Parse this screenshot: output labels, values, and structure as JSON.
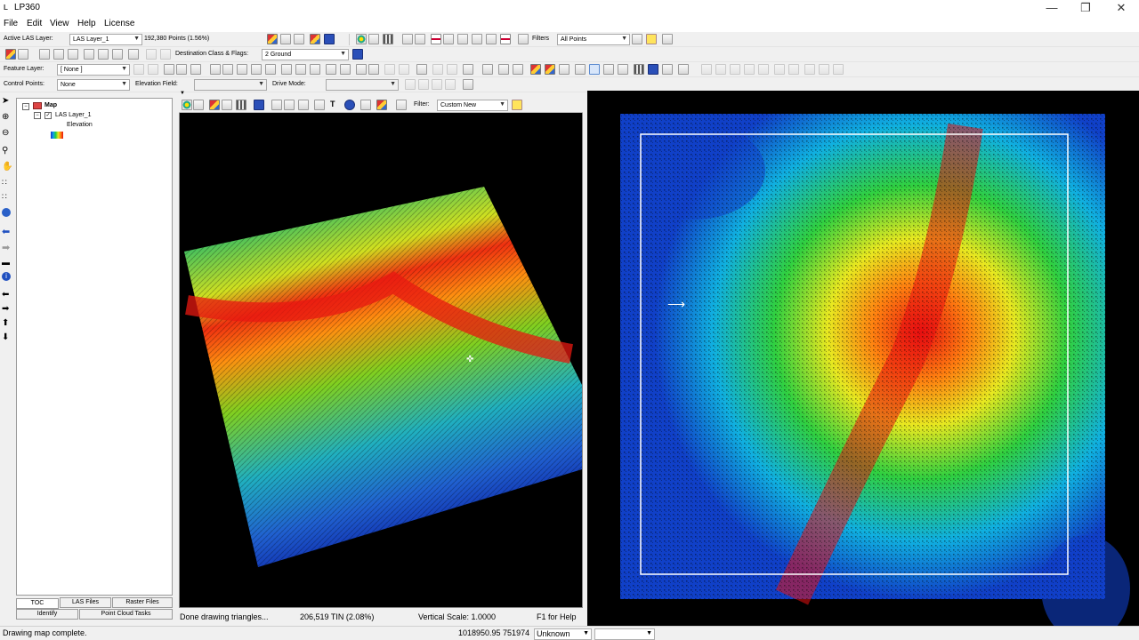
{
  "app": {
    "title": "LP360"
  },
  "menu": [
    "File",
    "Edit",
    "View",
    "Help",
    "License"
  ],
  "toolbar1": {
    "active_layer_label": "Active LAS Layer:",
    "active_layer_value": "LAS Layer_1",
    "points_info": "192,380 Points (1.56%)",
    "filters_label": "Filters",
    "filters_value": "All Points"
  },
  "toolbar2": {
    "dest_label": "Destination Class & Flags:",
    "dest_value": "2  Ground"
  },
  "toolbar3": {
    "feature_layer_label": "Feature Layer:",
    "feature_layer_value": "[ None ]"
  },
  "toolbar4": {
    "control_points_label": "Control Points:",
    "control_points_value": "None",
    "elevation_field_label": "Elevation Field:",
    "elevation_field_value": "",
    "drive_mode_label": "Drive Mode:",
    "drive_mode_value": ""
  },
  "toc": {
    "root": "Map",
    "layer": "LAS Layer_1",
    "sublayer": "Elevation",
    "tabs": [
      "TOC",
      "LAS Files",
      "Raster Files"
    ],
    "tabs2": [
      "Identify",
      "Point Cloud Tasks"
    ]
  },
  "view3d": {
    "filter_label": "Filter:",
    "filter_value": "Custom New",
    "status_text": "Done drawing triangles...",
    "tin_info": "206,519 TIN (2.08%)",
    "vertical_scale": "Vertical Scale: 1.0000",
    "help": "F1 for Help"
  },
  "status": {
    "message": "Drawing map complete.",
    "coords": "1018950.95  751974",
    "units": "Unknown",
    "extra": ""
  },
  "colors": {
    "elevation_ramp": [
      "#1030c8",
      "#10a0f0",
      "#20d040",
      "#e8e820",
      "#ff8010",
      "#e81010"
    ]
  }
}
